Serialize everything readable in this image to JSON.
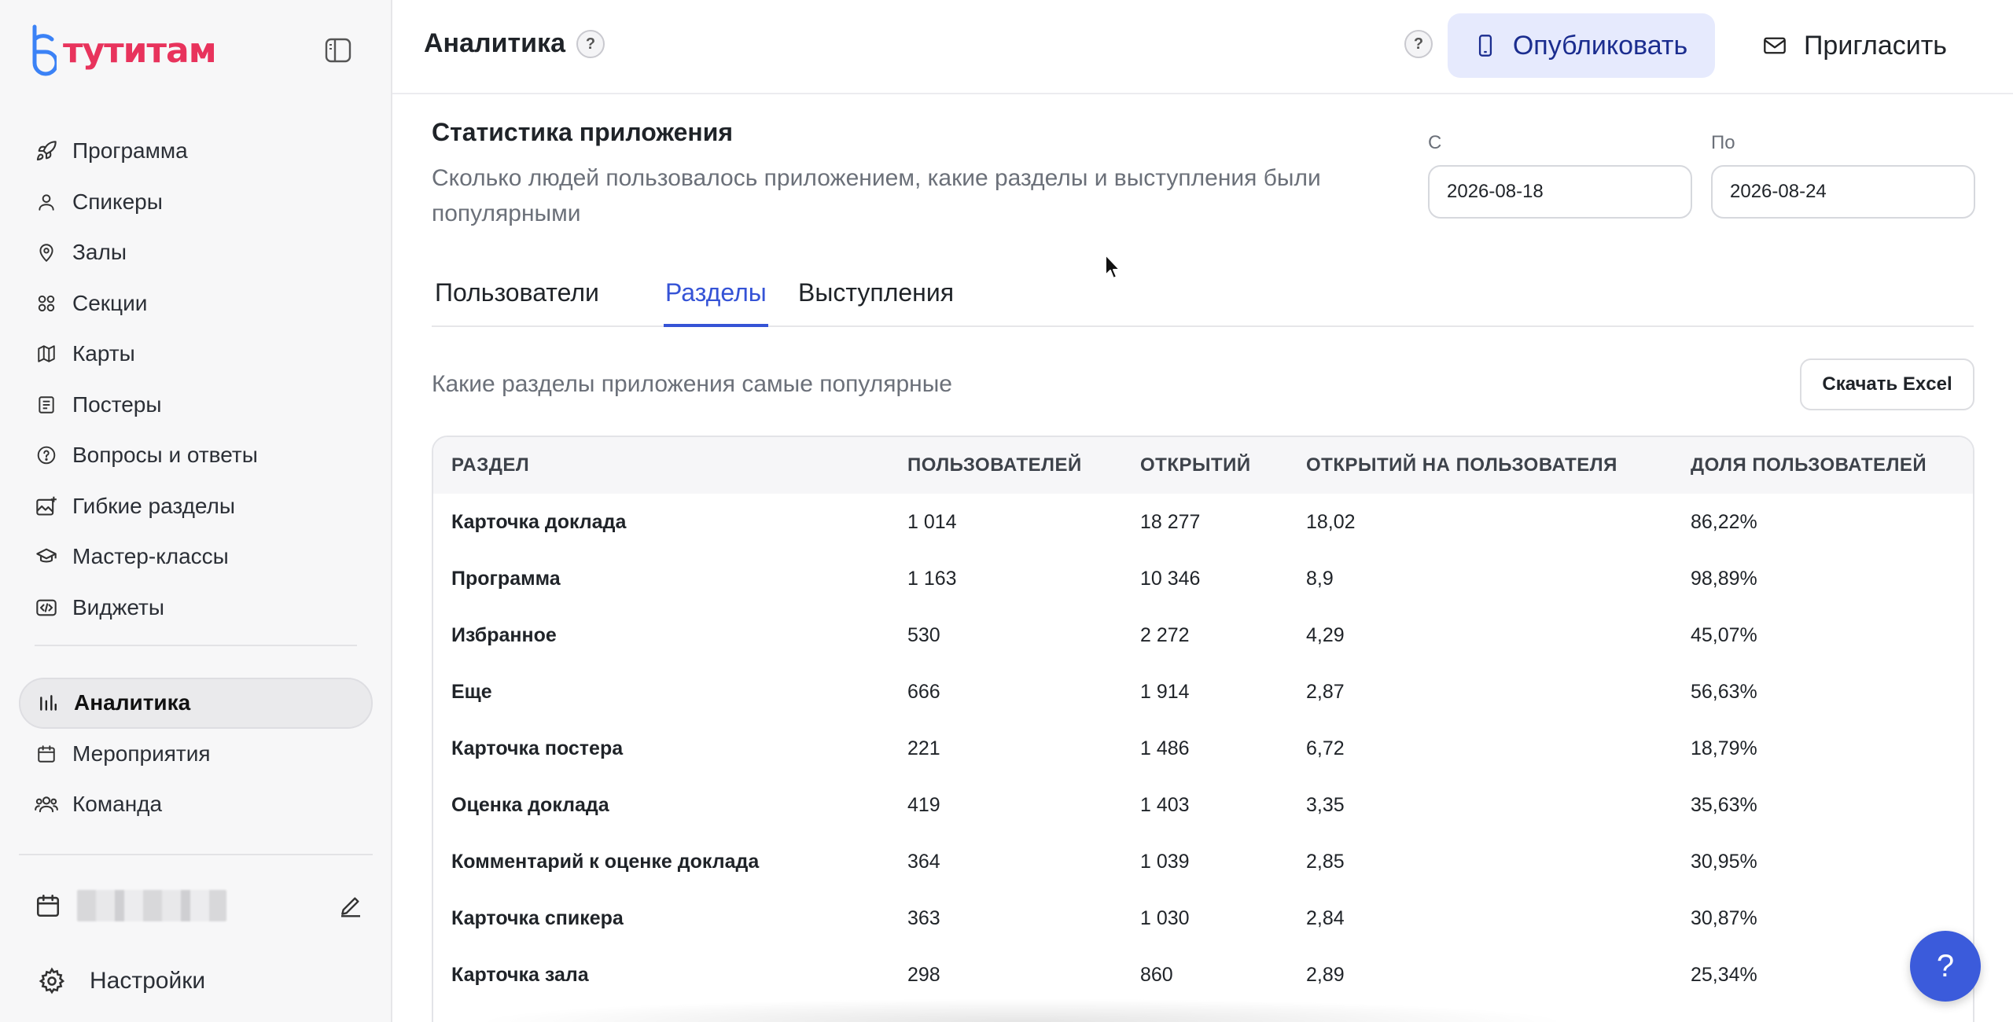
{
  "brand": {
    "logo_text": "тутитам",
    "color": "#e8335c",
    "mark_color": "#3b82f6"
  },
  "sidebar": {
    "items": [
      {
        "label": "Программа",
        "icon": "rocket-icon"
      },
      {
        "label": "Спикеры",
        "icon": "user-icon"
      },
      {
        "label": "Залы",
        "icon": "map-pin-icon"
      },
      {
        "label": "Секции",
        "icon": "grid-circles-icon"
      },
      {
        "label": "Карты",
        "icon": "map-icon"
      },
      {
        "label": "Постеры",
        "icon": "document-icon"
      },
      {
        "label": "Вопросы и ответы",
        "icon": "question-circle-icon"
      },
      {
        "label": "Гибкие разделы",
        "icon": "image-plus-icon"
      },
      {
        "label": "Мастер-классы",
        "icon": "graduation-cap-icon"
      },
      {
        "label": "Виджеты",
        "icon": "code-icon"
      }
    ],
    "items2": [
      {
        "label": "Аналитика",
        "icon": "bar-chart-icon",
        "active": true
      },
      {
        "label": "Мероприятия",
        "icon": "calendar-icon"
      },
      {
        "label": "Команда",
        "icon": "users-icon"
      }
    ],
    "settings_label": "Настройки"
  },
  "header": {
    "title": "Аналитика",
    "help": "?",
    "publish_label": "Опубликовать",
    "invite_label": "Пригласить"
  },
  "main": {
    "section_title": "Статистика приложения",
    "section_desc": "Сколько людей пользовалось приложением, какие разделы и выступления были популярными",
    "date_from_label": "С",
    "date_from_value": "2026-08-18",
    "date_to_label": "По",
    "date_to_value": "2026-08-24",
    "tabs": [
      "Пользователи",
      "Разделы",
      "Выступления"
    ],
    "active_tab": "Разделы",
    "subtitle": "Какие разделы приложения самые популярные",
    "excel_label": "Скачать Excel",
    "table": {
      "headers": [
        "РАЗДЕЛ",
        "ПОЛЬЗОВАТЕЛЕЙ",
        "ОТКРЫТИЙ",
        "ОТКРЫТИЙ НА ПОЛЬЗОВАТЕЛЯ",
        "ДОЛЯ ПОЛЬЗОВАТЕЛЕЙ"
      ],
      "rows": [
        [
          "Карточка доклада",
          "1 014",
          "18 277",
          "18,02",
          "86,22%"
        ],
        [
          "Программа",
          "1 163",
          "10 346",
          "8,9",
          "98,89%"
        ],
        [
          "Избранное",
          "530",
          "2 272",
          "4,29",
          "45,07%"
        ],
        [
          "Еще",
          "666",
          "1 914",
          "2,87",
          "56,63%"
        ],
        [
          "Карточка постера",
          "221",
          "1 486",
          "6,72",
          "18,79%"
        ],
        [
          "Оценка доклада",
          "419",
          "1 403",
          "3,35",
          "35,63%"
        ],
        [
          "Комментарий к оценке доклада",
          "364",
          "1 039",
          "2,85",
          "30,95%"
        ],
        [
          "Карточка спикера",
          "363",
          "1 030",
          "2,84",
          "30,87%"
        ],
        [
          "Карточка зала",
          "298",
          "860",
          "2,89",
          "25,34%"
        ]
      ]
    }
  },
  "fab_label": "?"
}
